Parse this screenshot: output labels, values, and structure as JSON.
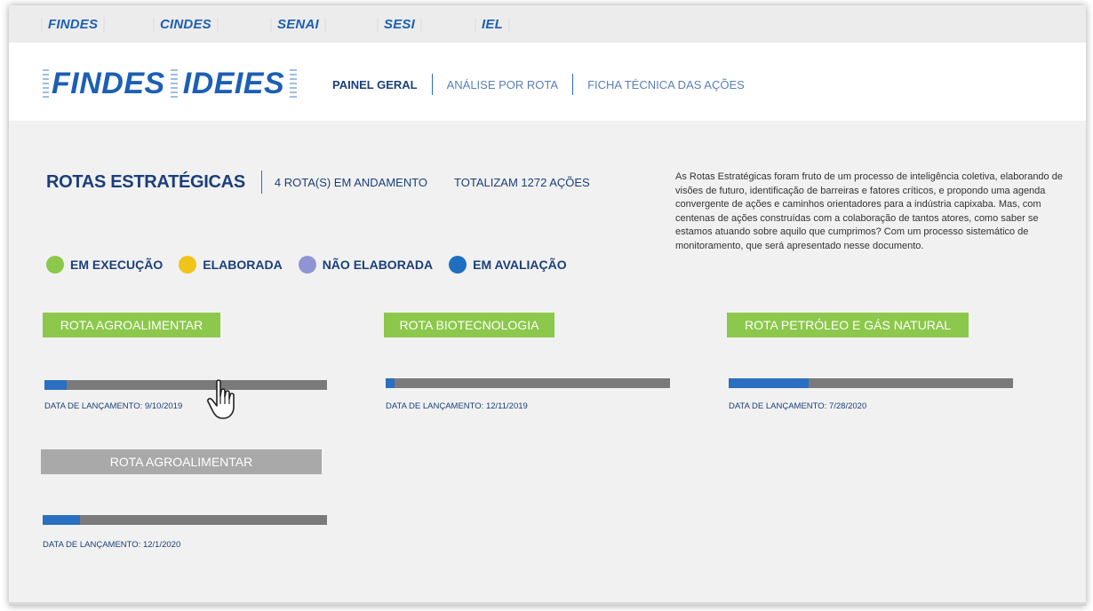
{
  "topbar": {
    "orgs": [
      "FINDES",
      "CINDES",
      "SENAI",
      "SESI",
      "IEL"
    ]
  },
  "header": {
    "logo_left": "FINDES",
    "logo_right": "IDEIES",
    "nav": [
      "PAINEL GERAL",
      "ANÁLISE POR ROTA",
      "FICHA TÉCNICA DAS AÇÕES"
    ],
    "active_nav": "PAINEL GERAL"
  },
  "summary": {
    "title": "ROTAS ESTRATÉGICAS",
    "rotas_info": "4 ROTA(S) EM ANDAMENTO",
    "acoes_info": "TOTALIZAM 1272 AÇÕES",
    "description": "As Rotas Estratégicas foram fruto de um processo de inteligência coletiva, elaborando de visões de futuro, identificação de barreiras e fatores críticos, e propondo uma agenda convergente de ações e caminhos orientadores para a indústria capixaba. Mas, com centenas de ações construídas com a colaboração de tantos atores, como saber se estamos atuando sobre aquilo que cumprimos? Com um processo sistemático de monitoramento, que será apresentado nesse documento."
  },
  "legend": [
    {
      "label": "EM EXECUÇÃO",
      "color": "#8cc84b"
    },
    {
      "label": "ELABORADA",
      "color": "#f0c419"
    },
    {
      "label": "NÃO ELABORADA",
      "color": "#8f95d3"
    },
    {
      "label": "EM AVALIAÇÃO",
      "color": "#1f6fc1"
    }
  ],
  "rotas": [
    {
      "name": "ROTA AGROALIMENTAR",
      "launch": "DATA DE LANÇAMENTO: 9/10/2019",
      "progress": 0.08,
      "style": "green"
    },
    {
      "name": "ROTA BIOTECNOLOGIA",
      "launch": "DATA DE LANÇAMENTO: 12/11/2019",
      "progress": 0.03,
      "style": "green"
    },
    {
      "name": "ROTA PETRÓLEO E GÁS NATURAL",
      "launch": "DATA DE LANÇAMENTO: 7/28/2020",
      "progress": 0.28,
      "style": "green"
    },
    {
      "name": "ROTA AGROALIMENTAR",
      "launch": "DATA DE LANÇAMENTO: 12/1/2020",
      "progress": 0.13,
      "style": "gray"
    }
  ],
  "colors": {
    "brand_blue": "#1d5fb4",
    "dark_blue": "#1b3f7a",
    "progress_fill": "#2a6fc1",
    "progress_track": "#7a7a7a"
  }
}
